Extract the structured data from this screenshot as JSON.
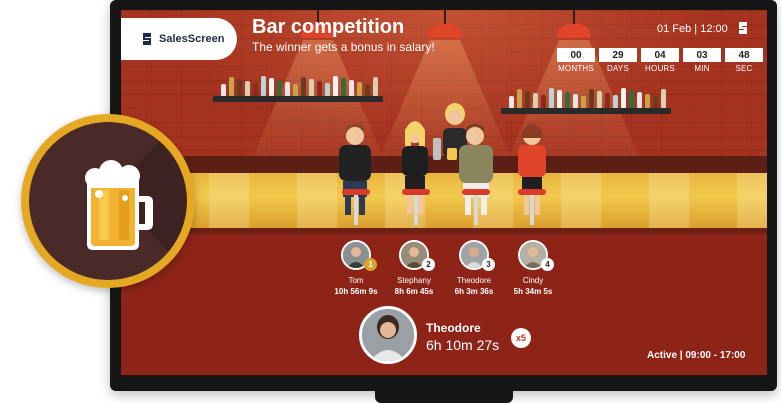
{
  "app": {
    "brand": "SalesScreen",
    "title": "Bar competition",
    "subtitle": "The winner gets a bonus in salary!"
  },
  "header": {
    "datetime": "01 Feb | 12:00"
  },
  "countdown": [
    {
      "value": "00",
      "label": "MONTHS"
    },
    {
      "value": "29",
      "label": "DAYS"
    },
    {
      "value": "04",
      "label": "HOURS"
    },
    {
      "value": "03",
      "label": "MIN"
    },
    {
      "value": "48",
      "label": "SEC"
    }
  ],
  "leaderboard": [
    {
      "rank": "1",
      "name": "Tom",
      "time": "10h 56m 9s"
    },
    {
      "rank": "2",
      "name": "Stephany",
      "time": "8h 6m 45s"
    },
    {
      "rank": "3",
      "name": "Theodore",
      "time": "6h 3m 36s"
    },
    {
      "rank": "4",
      "name": "Cindy",
      "time": "5h 34m 5s"
    }
  ],
  "featured": {
    "name": "Theodore",
    "time": "6h 10m 27s",
    "multiplier": "x5"
  },
  "status": "Active  |  09:00 - 17:00",
  "colors": {
    "wall": "#a5331f",
    "counter": "#f2c94c",
    "badge_ring": "#e4a823",
    "accent": "#c7321f"
  },
  "icons": [
    "salesscreen-logo-icon",
    "beer-mug-icon"
  ]
}
